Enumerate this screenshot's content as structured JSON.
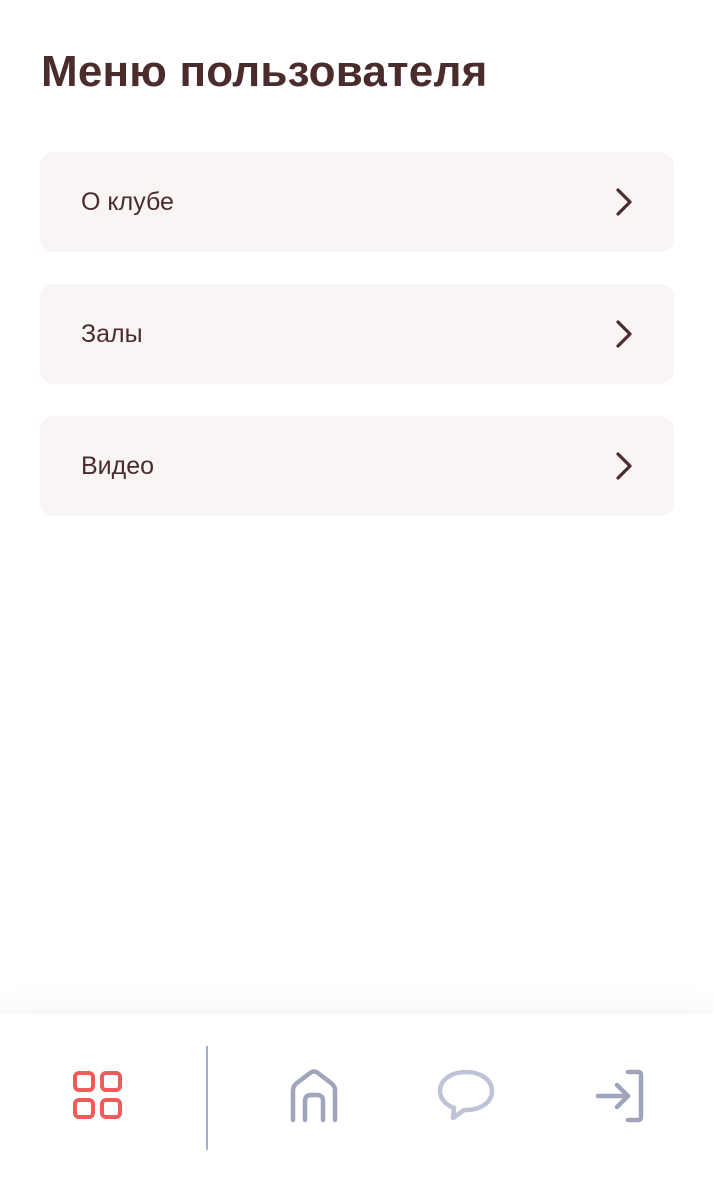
{
  "header": {
    "title": "Меню пользователя"
  },
  "menu": {
    "items": [
      {
        "label": "О клубе",
        "icon": "chevron-right-icon"
      },
      {
        "label": "Залы",
        "icon": "chevron-right-icon"
      },
      {
        "label": "Видео",
        "icon": "chevron-right-icon"
      }
    ]
  },
  "bottom_nav": {
    "items": [
      {
        "icon": "grid-menu-icon",
        "active": true
      },
      {
        "icon": "home-icon",
        "active": false
      },
      {
        "icon": "chat-bubble-icon",
        "active": false
      },
      {
        "icon": "login-icon",
        "active": false
      }
    ]
  },
  "colors": {
    "text": "#4a2c2c",
    "card_bg": "#f9f5f4",
    "accent": "#f05a5a",
    "nav_inactive": "#a0a5bb",
    "nav_chat": "#bfc3d6",
    "divider": "#a7adc6"
  }
}
